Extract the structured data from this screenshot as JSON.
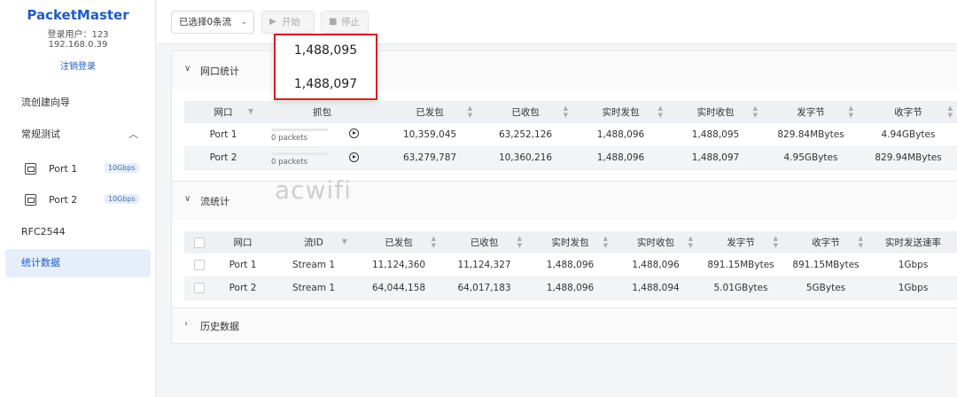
{
  "sidebar": {
    "brand": "PacketMaster",
    "user": "登录用户：123",
    "ip": "192.168.0.39",
    "logout": "注销登录",
    "nav": {
      "flow_wizard": "流创建向导",
      "regular_test": "常规测试",
      "rfc2544": "RFC2544",
      "stats": "统计数据"
    },
    "ports": [
      {
        "label": "Port 1",
        "speed": "10Gbps"
      },
      {
        "label": "Port 2",
        "speed": "10Gbps"
      }
    ]
  },
  "toolbar": {
    "select_label": "已选择0条流",
    "start_label": "开始",
    "stop_label": "停止"
  },
  "popup": {
    "values": [
      "1,488,095",
      "1,488,097"
    ]
  },
  "port_stats": {
    "title": "网口统计",
    "headers": [
      "网口",
      "抓包",
      "已发包",
      "已收包",
      "实时发包",
      "实时收包",
      "发字节",
      "收字节"
    ],
    "rows": [
      {
        "port": "Port 1",
        "capture": "0 packets",
        "tx": "10,359,045",
        "rx": "63,252,126",
        "rt_tx": "1,488,096",
        "rt_rx": "1,488,095",
        "tx_bytes": "829.84MBytes",
        "rx_bytes": "4.94GBytes"
      },
      {
        "port": "Port 2",
        "capture": "0 packets",
        "tx": "63,279,787",
        "rx": "10,360,216",
        "rt_tx": "1,488,096",
        "rt_rx": "1,488,097",
        "tx_bytes": "4.95GBytes",
        "rx_bytes": "829.94MBytes"
      }
    ]
  },
  "flow_stats": {
    "title": "流统计",
    "headers": [
      "网口",
      "流ID",
      "已发包",
      "已收包",
      "实时发包",
      "实时收包",
      "发字节",
      "收字节",
      "实时发送速率"
    ],
    "rows": [
      {
        "port": "Port 1",
        "stream": "Stream 1",
        "tx": "11,124,360",
        "rx": "11,124,327",
        "rt_tx": "1,488,096",
        "rt_rx": "1,488,096",
        "tx_bytes": "891.15MBytes",
        "rx_bytes": "891.15MBytes",
        "rate": "1Gbps"
      },
      {
        "port": "Port 2",
        "stream": "Stream 1",
        "tx": "64,044,158",
        "rx": "64,017,183",
        "rt_tx": "1,488,096",
        "rt_rx": "1,488,094",
        "tx_bytes": "5.01GBytes",
        "rx_bytes": "5GBytes",
        "rate": "1Gbps"
      }
    ]
  },
  "history": {
    "title": "历史数据"
  },
  "watermark": "acwifi"
}
